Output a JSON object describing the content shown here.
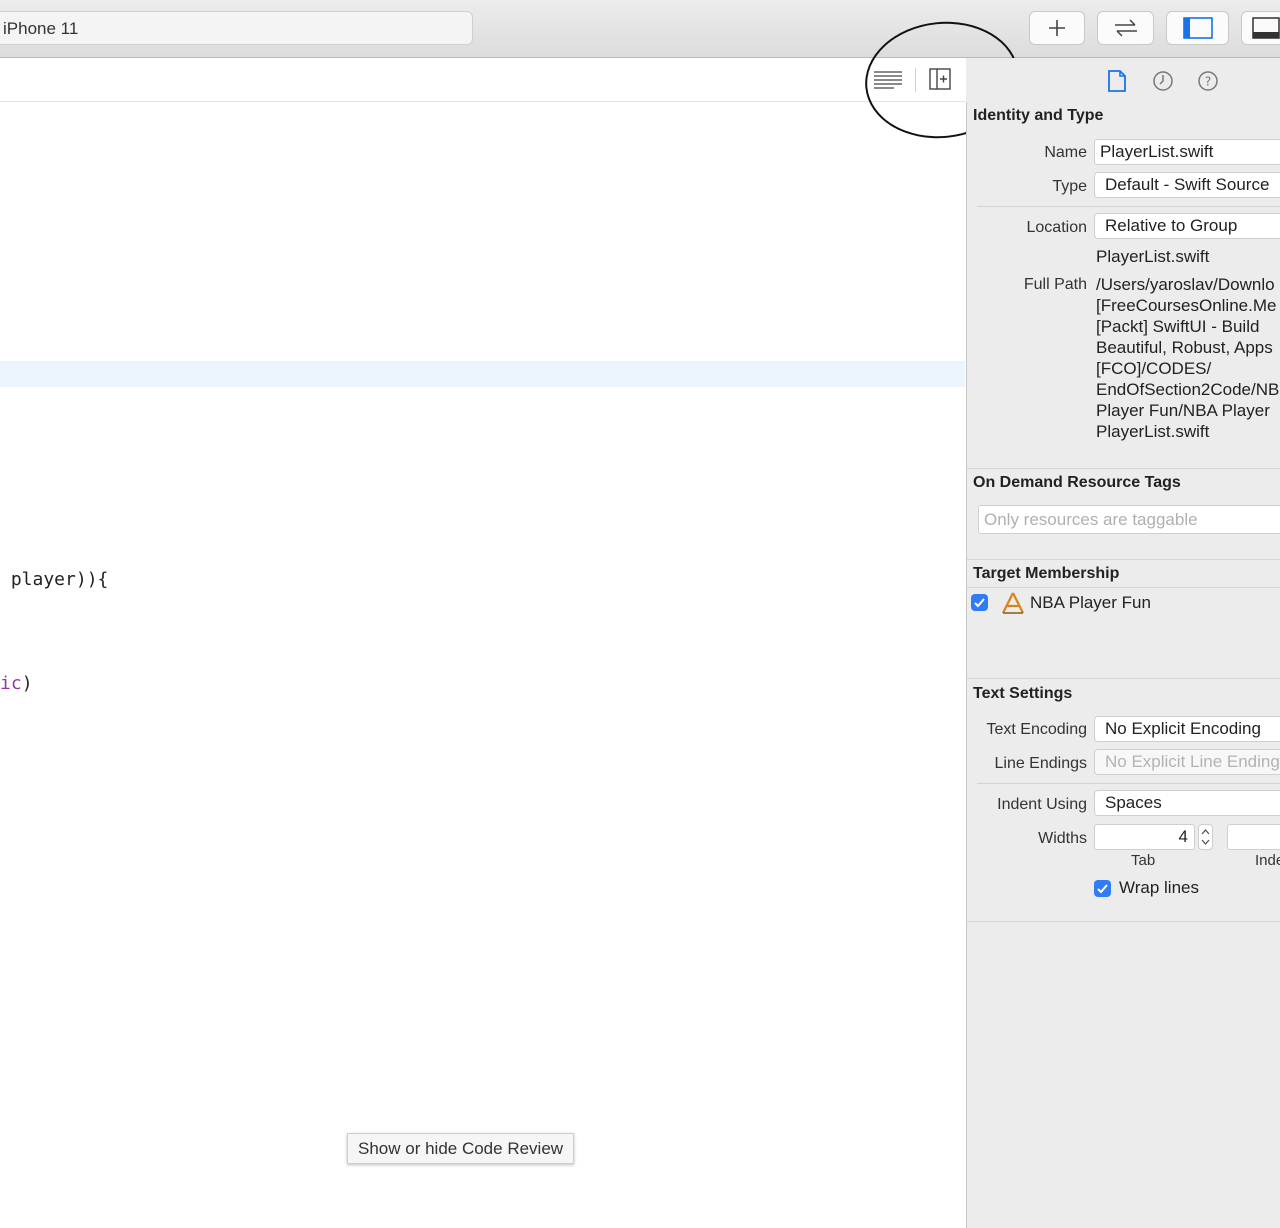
{
  "toolbar": {
    "scheme": "iPhone 11",
    "add_button_icon": "plus-icon",
    "back_forward_icon": "swap-arrows-icon",
    "navigator_toggle_icon": "left-panel-icon",
    "debug_toggle_icon": "bottom-panel-icon"
  },
  "editor": {
    "line_1": " player)){",
    "line_2_colored": "ic",
    "line_2_rest": ")",
    "tooltip": "Show or hide Code Review",
    "editor_options_icon": "lines-icon",
    "add_editor_icon": "split-add-icon"
  },
  "inspector": {
    "tabs": [
      "file-icon",
      "clock-icon",
      "help-icon"
    ],
    "identity": {
      "title": "Identity and Type",
      "name_label": "Name",
      "name_value": "PlayerList.swift",
      "type_label": "Type",
      "type_value": "Default - Swift Source",
      "location_label": "Location",
      "location_value": "Relative to Group",
      "location_file": "PlayerList.swift",
      "full_path_label": "Full Path",
      "full_path_lines": [
        "/Users/yaroslav/Downlo",
        "[FreeCoursesOnline.Me",
        "[Packt] SwiftUI - Build",
        "Beautiful, Robust, Apps",
        "[FCO]/CODES/",
        "EndOfSection2Code/NB",
        "Player Fun/NBA Player",
        "PlayerList.swift"
      ]
    },
    "on_demand": {
      "title": "On Demand Resource Tags",
      "placeholder": "Only resources are taggable"
    },
    "target_membership": {
      "title": "Target Membership",
      "target": "NBA Player Fun",
      "checked": true
    },
    "text_settings": {
      "title": "Text Settings",
      "encoding_label": "Text Encoding",
      "encoding_value": "No Explicit Encoding",
      "line_endings_label": "Line Endings",
      "line_endings_value": "No Explicit Line Ending",
      "indent_label": "Indent Using",
      "indent_value": "Spaces",
      "widths_label": "Widths",
      "tab_width": "4",
      "tab_caption": "Tab",
      "indent_caption": "Inde",
      "wrap_label": "Wrap lines",
      "wrap_checked": true
    }
  }
}
